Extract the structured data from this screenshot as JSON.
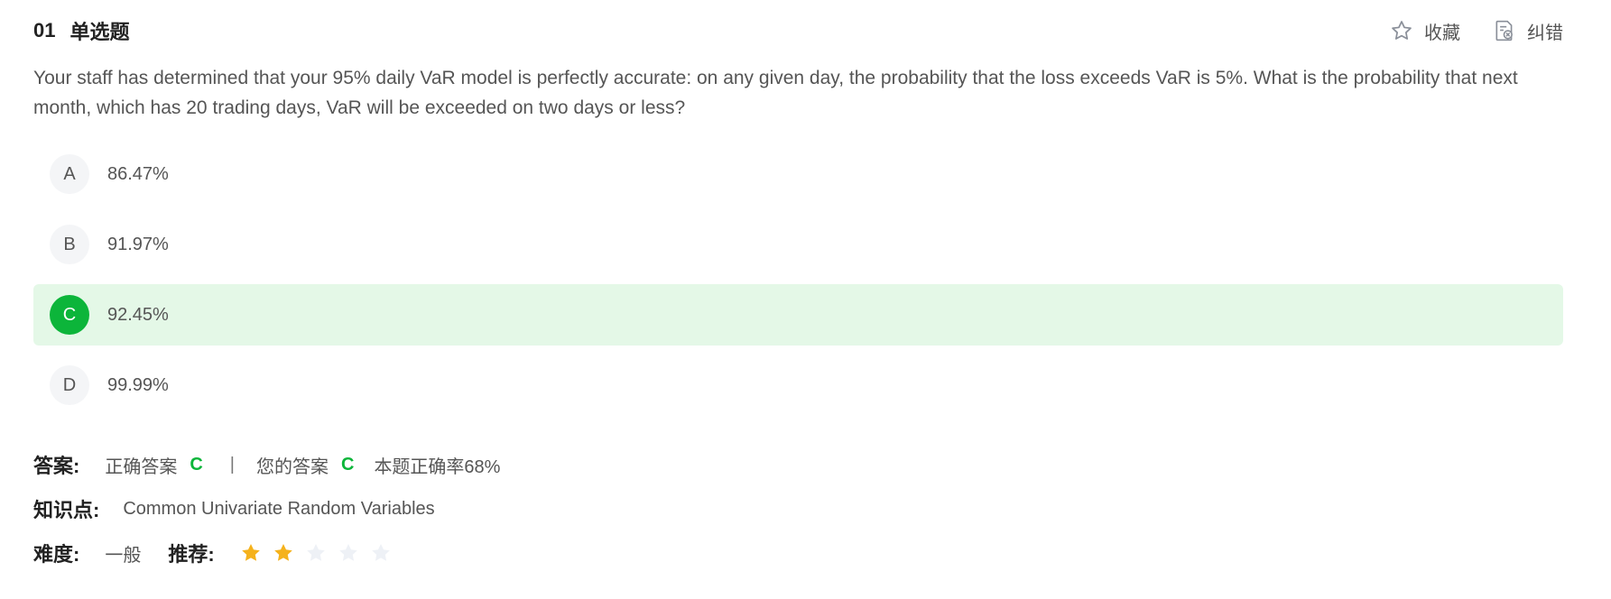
{
  "header": {
    "number": "01",
    "type": "单选题",
    "favorite_label": "收藏",
    "report_label": "纠错"
  },
  "question": {
    "text": "Your staff has determined that your 95% daily VaR model is perfectly accurate: on any given day, the probability that the loss exceeds VaR is 5%. What is the probability that next month, which has 20 trading days, VaR will be exceeded on two days or less?"
  },
  "options": [
    {
      "letter": "A",
      "text": "86.47%"
    },
    {
      "letter": "B",
      "text": "91.97%"
    },
    {
      "letter": "C",
      "text": "92.45%"
    },
    {
      "letter": "D",
      "text": "99.99%"
    }
  ],
  "selected_option": "C",
  "answer": {
    "label": "答案:",
    "correct_label": "正确答案",
    "correct_value": "C",
    "separator": "|",
    "your_label": "您的答案",
    "your_value": "C",
    "accuracy_text": "本题正确率68%"
  },
  "knowledge": {
    "label": "知识点:",
    "value": "Common Univariate Random Variables"
  },
  "difficulty": {
    "label": "难度:",
    "value": "一般",
    "recommend_label": "推荐:",
    "rating": 2,
    "max_rating": 5
  },
  "colors": {
    "accent_green": "#0cb53a",
    "selected_bg": "#e4f8e7",
    "star_filled": "#f5b21c",
    "star_empty": "#eef1f6"
  },
  "icons": {
    "favorite": "star-outline-icon",
    "report": "document-error-icon"
  }
}
